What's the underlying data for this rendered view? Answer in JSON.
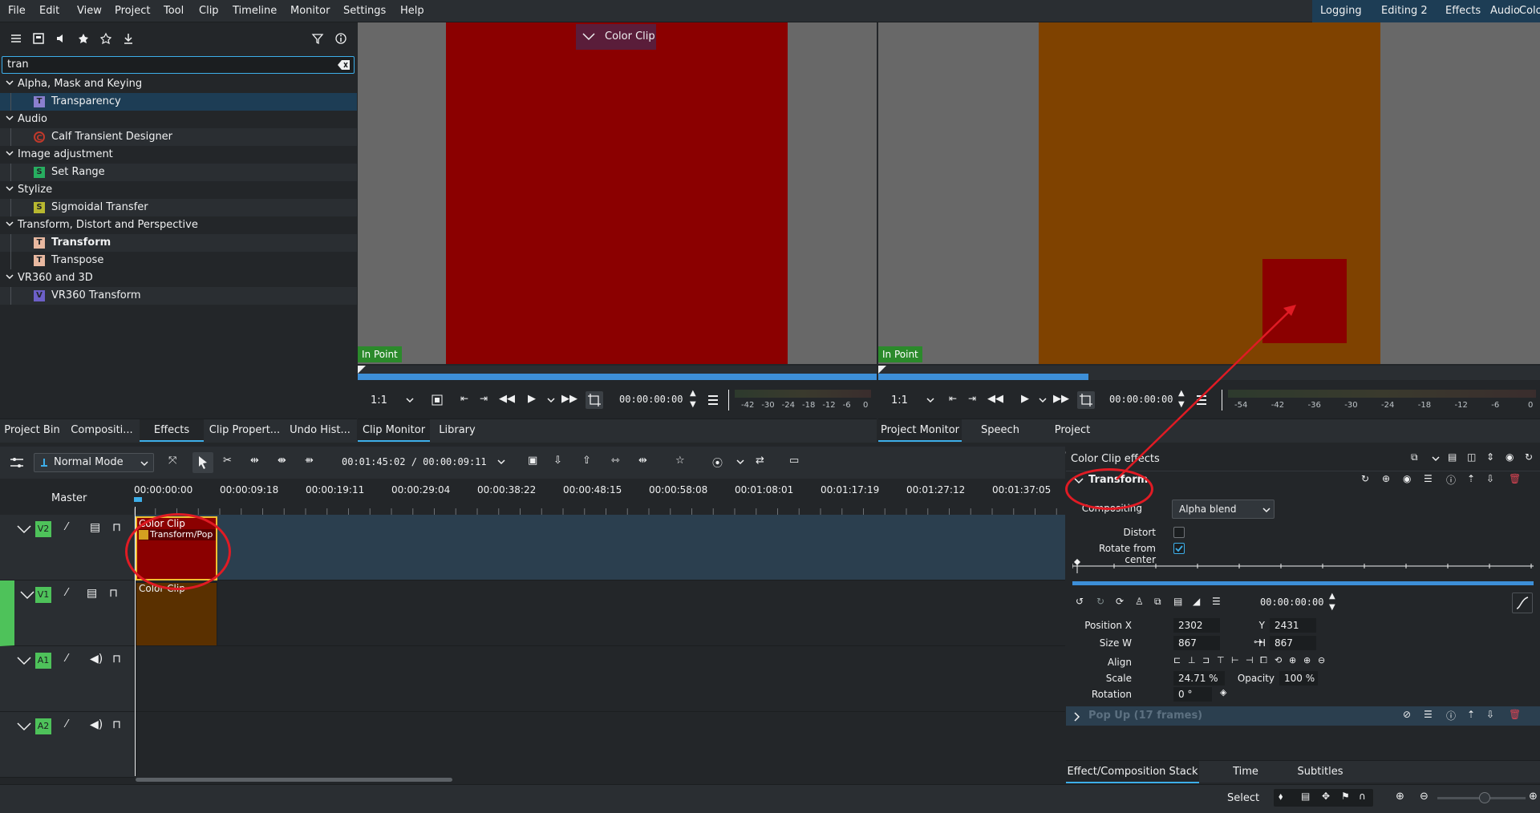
{
  "menu": [
    "File",
    "Edit",
    "View",
    "Project",
    "Tool",
    "Clip",
    "Timeline",
    "Monitor",
    "Settings",
    "Help"
  ],
  "workspaces": [
    "Logging",
    "Editing 2",
    "Effects",
    "Audio",
    "Color"
  ],
  "effects_panel": {
    "search_value": "tran",
    "categories": [
      {
        "label": "Alpha, Mask and Keying",
        "items": [
          {
            "badge": "T",
            "label": "Transparency",
            "color": "#8a7fcf"
          }
        ]
      },
      {
        "label": "Audio",
        "items": [
          {
            "badge": "C",
            "label": "Calf Transient Designer",
            "color": "#c0392b"
          }
        ]
      },
      {
        "label": "Image adjustment",
        "items": [
          {
            "badge": "S",
            "label": "Set Range",
            "color": "#27ae60"
          }
        ]
      },
      {
        "label": "Stylize",
        "items": [
          {
            "badge": "S",
            "label": "Sigmoidal Transfer",
            "color": "#b8b830"
          }
        ]
      },
      {
        "label": "Transform, Distort and Perspective",
        "items": [
          {
            "badge": "T",
            "label": "Transform",
            "color": "#e8b8a0"
          },
          {
            "badge": "T",
            "label": "Transpose",
            "color": "#e8b8a0"
          }
        ]
      },
      {
        "label": "VR360 and 3D",
        "items": [
          {
            "badge": "V",
            "label": "VR360 Transform",
            "color": "#6c5fc7"
          }
        ]
      }
    ]
  },
  "left_tabs": [
    "Project Bin",
    "Compositi...",
    "Effects",
    "Clip Propert...",
    "Undo Hist..."
  ],
  "clip_monitor": {
    "overlay_label": "Color Clip",
    "in_point": "In Point",
    "zoom": "1:1",
    "timecode": "00:00:00:00",
    "vu_labels": [
      "-42",
      "-30",
      "-24",
      "-18",
      "-12",
      "-6",
      "0"
    ],
    "tabs": [
      "Clip Monitor",
      "Library"
    ]
  },
  "project_monitor": {
    "in_point": "In Point",
    "zoom": "1:1",
    "timecode": "00:00:00:00",
    "vu_labels": [
      "-54",
      "-42",
      "-36",
      "-30",
      "-24",
      "-18",
      "-12",
      "-6",
      "0"
    ],
    "tabs": [
      "Project Monitor",
      "Speech Editor",
      "Project Notes"
    ]
  },
  "timeline": {
    "mode": "Normal Mode",
    "timecode": "00:01:45:02 / 00:00:09:11",
    "master_label": "Master",
    "ruler": [
      "00:00:00:00",
      "00:00:09:18",
      "00:00:19:11",
      "00:00:29:04",
      "00:00:38:22",
      "00:00:48:15",
      "00:00:58:08",
      "00:01:08:01",
      "00:01:17:19",
      "00:01:27:12",
      "00:01:37:05"
    ],
    "tracks": [
      "V2",
      "V1",
      "A1",
      "A2"
    ],
    "clip_v2_title": "Color Clip",
    "clip_v2_effect": "Transform/Pop",
    "clip_v1_title": "Color Clip"
  },
  "effect_stack": {
    "title": "Color Clip effects",
    "effect_name": "Transform",
    "compositing_label": "Compositing",
    "compositing_value": "Alpha blend",
    "distort_label": "Distort",
    "rotate_label": "Rotate from center",
    "keyframe_time": "00:00:00:00",
    "position_x_label": "Position X",
    "position_x": "2302",
    "y_label": "Y",
    "position_y": "2431",
    "size_w_label": "Size W",
    "size_w": "867",
    "h_label": "H",
    "size_h": "867",
    "align_label": "Align",
    "scale_label": "Scale",
    "scale": "24.71 %",
    "opacity_label": "Opacity",
    "opacity": "100 %",
    "rotation_label": "Rotation",
    "rotation": "0 °",
    "second_effect": "Pop Up (17 frames)",
    "tabs": [
      "Effect/Composition Stack",
      "Time Remapping",
      "Subtitles"
    ]
  },
  "status": {
    "select_label": "Select"
  },
  "colors": {
    "accent": "#3daee9",
    "clip_red": "#8b0000",
    "clip_orange": "#7f4200",
    "annotation": "#e01b24",
    "track_green": "#4ec25a"
  }
}
